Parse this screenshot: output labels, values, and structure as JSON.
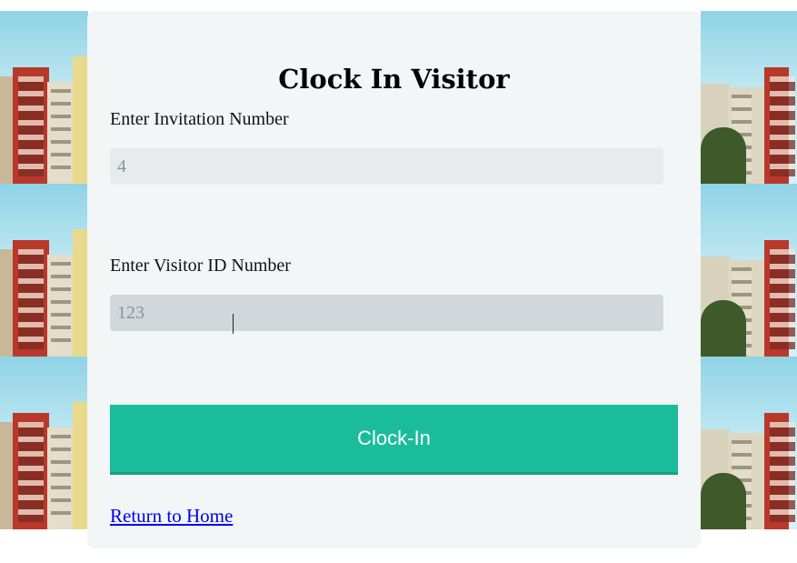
{
  "page": {
    "title": "Clock In Visitor"
  },
  "form": {
    "invitation_label": "Enter Invitation Number",
    "invitation_value": "4",
    "visitor_id_label": "Enter Visitor ID Number",
    "visitor_id_value": "123",
    "submit_label": "Clock-In"
  },
  "footer": {
    "return_link": "Return to Home"
  },
  "colors": {
    "button": "#1abc9c",
    "card": "#f2f6f7",
    "link": "#0000ee"
  },
  "background": {
    "image": "building-photo-tiles"
  }
}
